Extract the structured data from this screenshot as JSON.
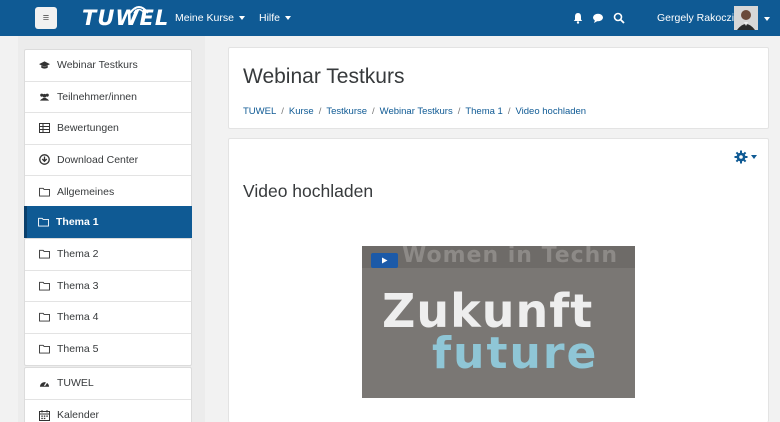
{
  "navbar": {
    "brand": "TUWEL",
    "menu": [
      {
        "label": "Meine Kurse"
      },
      {
        "label": "Hilfe"
      }
    ],
    "user_name": "Gergely Rakoczi",
    "icons": [
      "bell-icon",
      "chat-icon",
      "search-icon"
    ]
  },
  "drawer": {
    "course_items": [
      {
        "label": "Webinar Testkurs",
        "icon": "graduation-cap-icon"
      },
      {
        "label": "Teilnehmer/innen",
        "icon": "users-icon"
      },
      {
        "label": "Bewertungen",
        "icon": "table-icon"
      },
      {
        "label": "Download Center",
        "icon": "download-icon"
      },
      {
        "label": "Allgemeines",
        "icon": "folder-icon"
      },
      {
        "label": "Thema 1",
        "icon": "folder-icon",
        "active": true
      },
      {
        "label": "Thema 2",
        "icon": "folder-icon"
      },
      {
        "label": "Thema 3",
        "icon": "folder-icon"
      },
      {
        "label": "Thema 4",
        "icon": "folder-icon"
      },
      {
        "label": "Thema 5",
        "icon": "folder-icon"
      }
    ],
    "site_items": [
      {
        "label": "TUWEL",
        "icon": "dashboard-icon"
      },
      {
        "label": "Kalender",
        "icon": "calendar-icon"
      }
    ]
  },
  "header": {
    "title": "Webinar Testkurs",
    "breadcrumb": [
      "TUWEL",
      "Kurse",
      "Testkurse",
      "Webinar Testkurs",
      "Thema 1",
      "Video hochladen"
    ]
  },
  "main": {
    "section_title": "Video hochladen",
    "video": {
      "overlay_text": "Women in Techn",
      "headline": "Zukunft",
      "subline": "future"
    }
  },
  "colors": {
    "primary": "#0f5a94",
    "background": "#f2f2f2",
    "video_accent": "#8fc6d6"
  }
}
